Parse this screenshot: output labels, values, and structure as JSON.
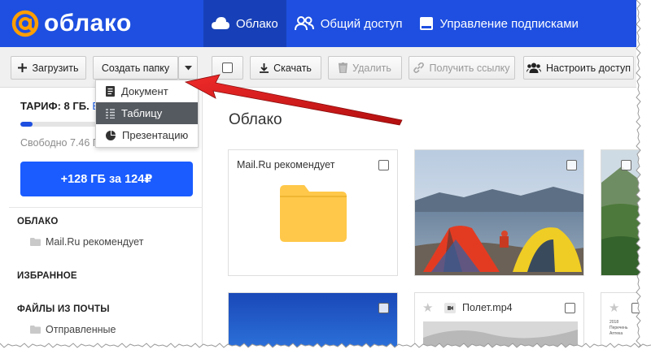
{
  "header": {
    "logo_text": "облако",
    "nav": [
      {
        "label": "Облако",
        "icon": "cloud-icon",
        "active": true
      },
      {
        "label": "Общий доступ",
        "icon": "users-icon",
        "active": false
      },
      {
        "label": "Управление подписками",
        "icon": "subscriptions-icon",
        "active": false
      }
    ]
  },
  "toolbar": {
    "upload": "Загрузить",
    "create_folder": "Создать папку",
    "download": "Скачать",
    "delete": "Удалить",
    "get_link": "Получить ссылку",
    "share_settings": "Настроить доступ"
  },
  "create_menu": {
    "items": [
      {
        "label": "Документ",
        "icon": "document-icon",
        "selected": false
      },
      {
        "label": "Таблицу",
        "icon": "table-icon",
        "selected": true
      },
      {
        "label": "Презентацию",
        "icon": "presentation-icon",
        "selected": false
      }
    ]
  },
  "sidebar": {
    "tariff": "ТАРИФ: 8 ГБ.",
    "tariff_link": "В",
    "storage_used_fraction": 0.1,
    "free_space": "Свободно 7.46 Г",
    "buy_button": "+128 ГБ за 124₽",
    "sections": [
      {
        "title": "ОБЛАКО",
        "folders": [
          "Mail.Ru рекомендует"
        ]
      },
      {
        "title": "ИЗБРАННОЕ",
        "folders": []
      },
      {
        "title": "ФАЙЛЫ ИЗ ПОЧТЫ",
        "folders": [
          "Отправленные"
        ]
      }
    ]
  },
  "main": {
    "title": "Облако",
    "items": [
      {
        "type": "folder",
        "name": "Mail.Ru рекомендует"
      },
      {
        "type": "image",
        "name": ""
      },
      {
        "type": "image",
        "name": ""
      },
      {
        "type": "image",
        "name": ""
      },
      {
        "type": "video",
        "name": "Полет.mp4"
      },
      {
        "type": "document",
        "name": "",
        "preview_lines": [
          "2018",
          "Перечень",
          "Аптека"
        ]
      }
    ]
  },
  "colors": {
    "header_bg": "#1e4fe0",
    "header_active": "#1740b8",
    "buy_button": "#1a5cff",
    "annotation_arrow": "#e21c1c",
    "folder": "#ffc84a"
  }
}
